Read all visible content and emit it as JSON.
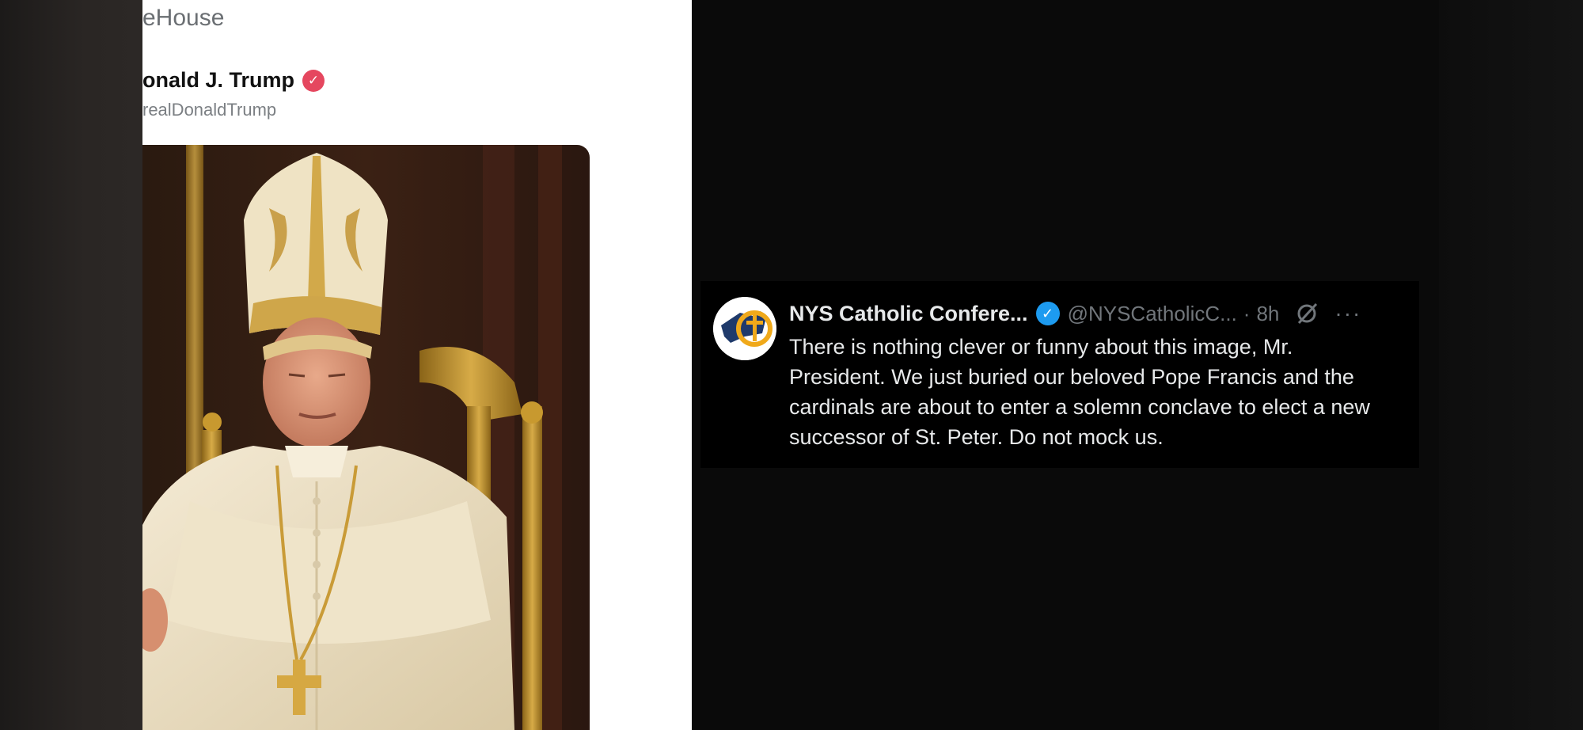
{
  "left_post": {
    "account_label": "eHouse",
    "author_name": "onald J. Trump",
    "author_handle": "realDonaldTrump",
    "image_label": "AI-generated image of Donald J. Trump dressed as the Pope"
  },
  "reply_tweet": {
    "display_name": "NYS Catholic Confere...",
    "handle": "@NYSCatholicC...",
    "separator": "·",
    "time": "8h",
    "more_glyph": "···",
    "text": "There is nothing clever or funny about this image, Mr. President. We just buried our beloved Pope Francis and the cardinals are about to enter a solemn conclave to elect a new successor of St. Peter. Do not mock us."
  },
  "icons": {
    "verified_red": "verified-badge-icon",
    "verified_blue": "verified-badge-icon",
    "grok": "grok-icon",
    "more": "more-options-icon"
  },
  "colors": {
    "verified_red": "#e5475f",
    "verified_blue": "#1d9bf0",
    "tweet_text": "#e7e9ea",
    "muted": "#71767b"
  }
}
